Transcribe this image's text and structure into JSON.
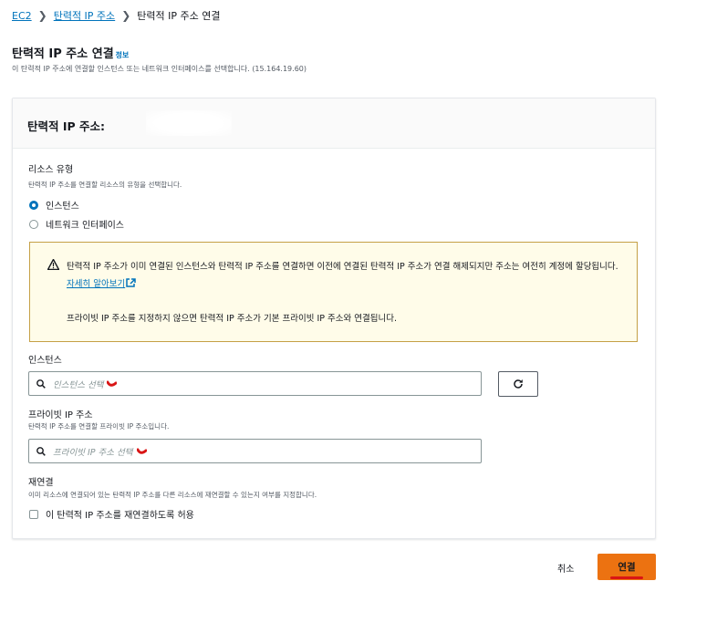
{
  "breadcrumb": {
    "items": [
      {
        "label": "EC2"
      },
      {
        "label": "탄력적 IP 주소"
      },
      {
        "label": "탄력적 IP 주소 연결"
      }
    ]
  },
  "page": {
    "title": "탄력적 IP 주소 연결",
    "info_label": "정보",
    "description": "이 탄력적 IP 주소에 연결할 인스턴스 또는 네트워크 인터페이스를 선택합니다. (15.164.19.60)"
  },
  "card": {
    "title": "탄력적 IP 주소:"
  },
  "resource_type": {
    "label": "리소스 유형",
    "description": "탄력적 IP 주소를 연결할 리소스의 유형을 선택합니다.",
    "options": [
      {
        "label": "인스턴스",
        "selected": true
      },
      {
        "label": "네트워크 인터페이스",
        "selected": false
      }
    ]
  },
  "alert": {
    "text": "탄력적 IP 주소가 이미 연결된 인스턴스와 탄력적 IP 주소를 연결하면 이전에 연결된 탄력적 IP 주소가 연결 해제되지만 주소는 여전히 계정에 할당됩니다.",
    "link": "자세히 알아보기",
    "note": "프라이빗 IP 주소를 지정하지 않으면 탄력적 IP 주소가 기본 프라이빗 IP 주소와 연결됩니다."
  },
  "instance": {
    "label": "인스턴스",
    "placeholder": "인스턴스 선택"
  },
  "private_ip": {
    "label": "프라이빗 IP 주소",
    "description": "탄력적 IP 주소를 연결할 프라이빗 IP 주소입니다.",
    "placeholder": "프라이빗 IP 주소 선택"
  },
  "reassociation": {
    "label": "재연결",
    "description": "이미 리소스에 연결되어 있는 탄력적 IP 주소를 다른 리소스에 재연결할 수 있는지 여부를 지정합니다.",
    "checkbox_label": "이 탄력적 IP 주소를 재연결하도록 허용",
    "checked": false
  },
  "actions": {
    "cancel": "취소",
    "connect": "연결"
  },
  "colors": {
    "link": "#0073bb",
    "primary_button": "#ec7211",
    "warning_border": "#c5a046",
    "warning_bg": "#fffce9",
    "annotation_red": "#d91515"
  }
}
